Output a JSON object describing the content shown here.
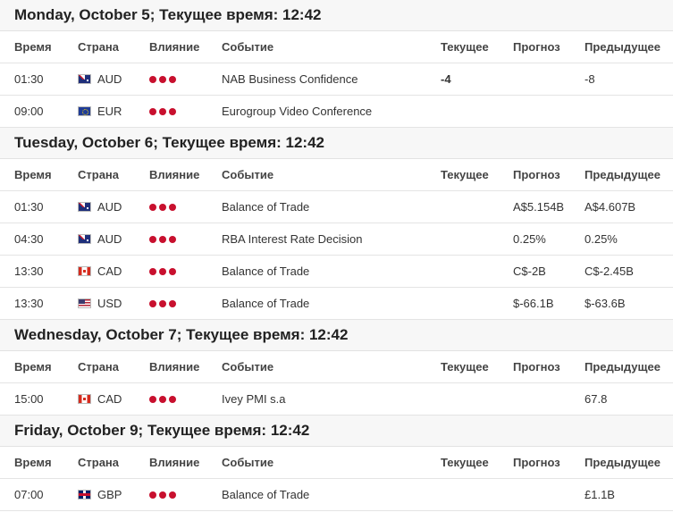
{
  "colors": {
    "impact_high": "#c8102e",
    "header_bg": "#f7f7f7"
  },
  "columns": {
    "time": "Время",
    "country": "Страна",
    "impact": "Влияние",
    "event": "Событие",
    "actual": "Текущее",
    "forecast": "Прогноз",
    "previous": "Предыдущее"
  },
  "days": [
    {
      "title": "Monday, October 5; Текущее время: 12:42",
      "events": [
        {
          "time": "01:30",
          "flag": "australia-flag-icon",
          "currency": "AUD",
          "impact": "high",
          "event": "NAB Business Confidence",
          "actual": "-4",
          "forecast": "",
          "previous": "-8"
        },
        {
          "time": "09:00",
          "flag": "eu-flag-icon",
          "currency": "EUR",
          "impact": "high",
          "event": "Eurogroup Video Conference",
          "actual": "",
          "forecast": "",
          "previous": ""
        }
      ]
    },
    {
      "title": "Tuesday, October 6; Текущее время: 12:42",
      "events": [
        {
          "time": "01:30",
          "flag": "australia-flag-icon",
          "currency": "AUD",
          "impact": "high",
          "event": "Balance of Trade",
          "actual": "",
          "forecast": "A$5.154B",
          "previous": "A$4.607B"
        },
        {
          "time": "04:30",
          "flag": "australia-flag-icon",
          "currency": "AUD",
          "impact": "high",
          "event": "RBA Interest Rate Decision",
          "actual": "",
          "forecast": "0.25%",
          "previous": "0.25%"
        },
        {
          "time": "13:30",
          "flag": "canada-flag-icon",
          "currency": "CAD",
          "impact": "high",
          "event": "Balance of Trade",
          "actual": "",
          "forecast": "C$-2B",
          "previous": "C$-2.45B"
        },
        {
          "time": "13:30",
          "flag": "usa-flag-icon",
          "currency": "USD",
          "impact": "high",
          "event": "Balance of Trade",
          "actual": "",
          "forecast": "$-66.1B",
          "previous": "$-63.6B"
        }
      ]
    },
    {
      "title": "Wednesday, October 7; Текущее время: 12:42",
      "events": [
        {
          "time": "15:00",
          "flag": "canada-flag-icon",
          "currency": "CAD",
          "impact": "high",
          "event": "Ivey PMI s.a",
          "actual": "",
          "forecast": "",
          "previous": "67.8"
        }
      ]
    },
    {
      "title": "Friday, October 9; Текущее время: 12:42",
      "events": [
        {
          "time": "07:00",
          "flag": "uk-flag-icon",
          "currency": "GBP",
          "impact": "high",
          "event": "Balance of Trade",
          "actual": "",
          "forecast": "",
          "previous": "£1.1B"
        }
      ]
    }
  ]
}
